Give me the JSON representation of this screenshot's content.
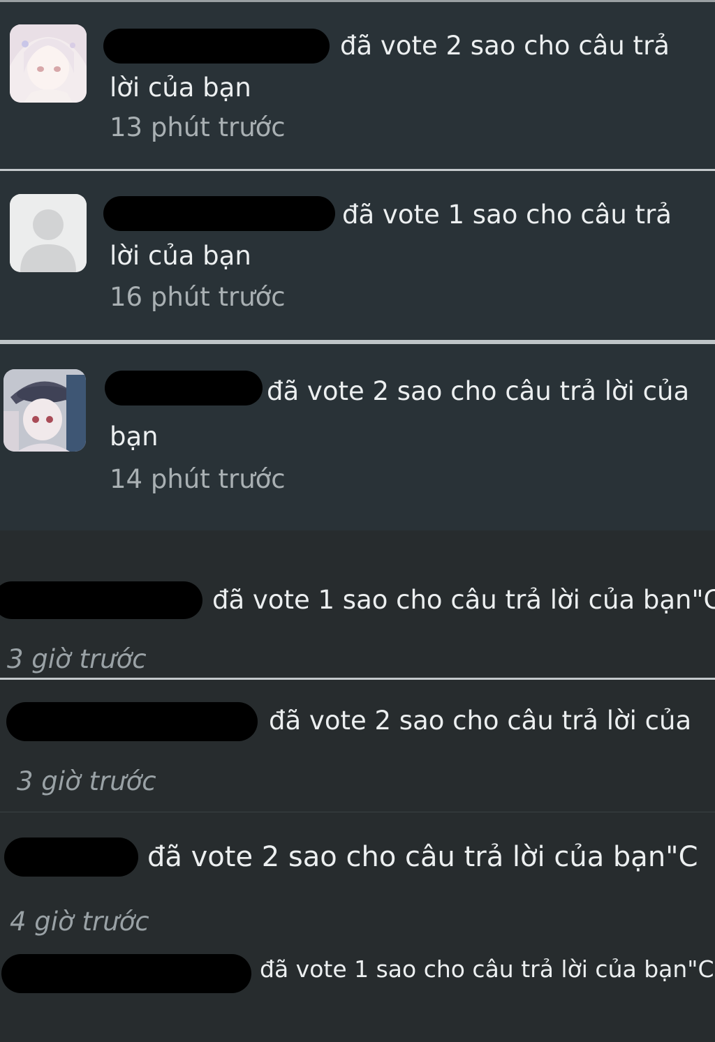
{
  "notifications": [
    {
      "message": "đã vote 2 sao cho câu trả",
      "message_cont": "lời của bạn",
      "time": "13 phút trước"
    },
    {
      "message": "đã vote 1 sao cho câu trả",
      "message_cont": "lời của bạn",
      "time": "16 phút trước"
    },
    {
      "message": "đã vote 2 sao cho câu trả lời của",
      "message_cont": "bạn",
      "time": "14 phút trước"
    },
    {
      "message": "đã vote 1 sao cho câu trả lời của bạn\"C",
      "time": "3 giờ trước"
    },
    {
      "message": "đã vote 2 sao cho câu trả lời của",
      "time": "3 giờ trước"
    },
    {
      "message": "đã vote 2 sao cho câu trả lời của bạn\"C",
      "time": "4 giờ trước"
    },
    {
      "message": "đã vote 1 sao cho câu trả lời của bạn\"C"
    }
  ],
  "colors": {
    "panel_bg": "#293237",
    "page_bg": "#272c2e",
    "text": "#eceff0",
    "muted": "#a9b0b3"
  },
  "icons": {
    "avatar_1": "anime-girl-avatar",
    "avatar_2": "default-user-avatar",
    "avatar_3": "anime-hat-avatar"
  }
}
